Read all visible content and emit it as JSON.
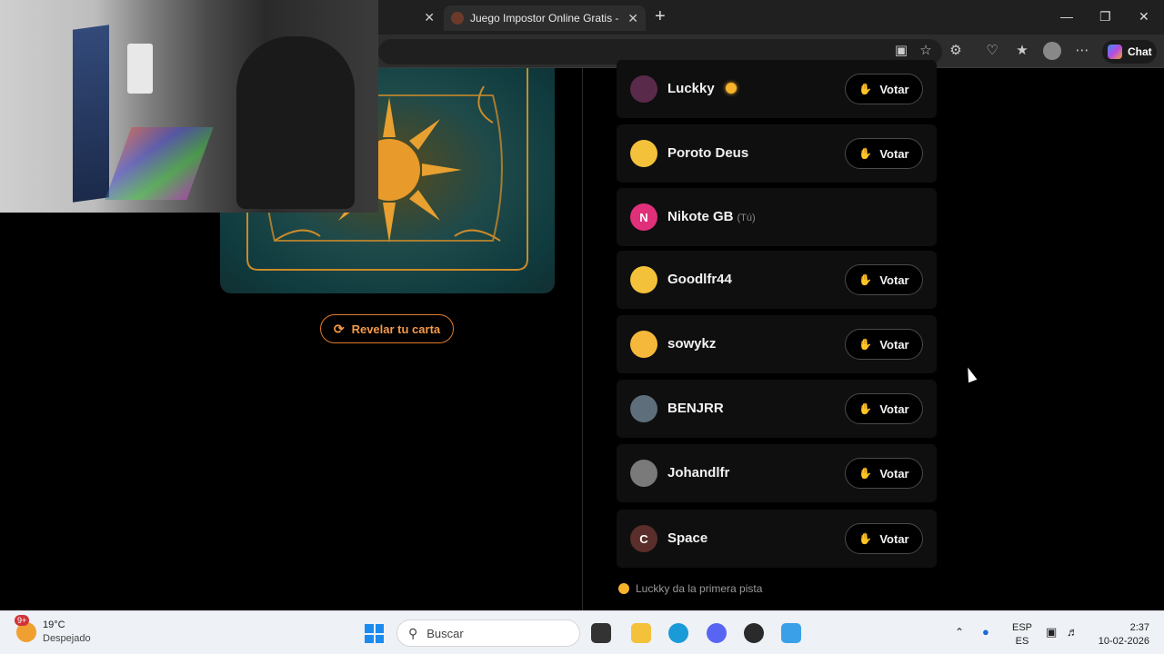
{
  "browser": {
    "prev_tab_close": "✕",
    "active_tab_title": "Juego Impostor Online Gratis - Juego",
    "active_tab_close": "✕",
    "new_tab": "+",
    "chat_label": "Chat"
  },
  "game": {
    "reveal_label": "Revelar tu carta",
    "vote_label": "Votar",
    "you_tag": "(Tú)",
    "players": [
      {
        "name": "Luckky",
        "avatar_text": "",
        "avatar_color": "#5a2a4a",
        "clue_badge": true,
        "can_vote": true
      },
      {
        "name": "Poroto Deus",
        "avatar_text": "",
        "avatar_color": "#f3c13a",
        "clue_badge": false,
        "can_vote": true
      },
      {
        "name": "Nikote GB",
        "avatar_text": "N",
        "avatar_color": "#e0307a",
        "clue_badge": false,
        "can_vote": false,
        "is_you": true
      },
      {
        "name": "Goodlfr44",
        "avatar_text": "",
        "avatar_color": "#f3c13a",
        "clue_badge": false,
        "can_vote": true
      },
      {
        "name": "sowykz",
        "avatar_text": "",
        "avatar_color": "#f5b83a",
        "clue_badge": false,
        "can_vote": true
      },
      {
        "name": "BENJRR",
        "avatar_text": "",
        "avatar_color": "#5e6e7a",
        "clue_badge": false,
        "can_vote": true
      },
      {
        "name": "Johandlfr",
        "avatar_text": "",
        "avatar_color": "#7a7a7a",
        "clue_badge": false,
        "can_vote": true
      },
      {
        "name": "Space",
        "avatar_text": "C",
        "avatar_color": "#5a2e2a",
        "clue_badge": false,
        "can_vote": true
      }
    ],
    "hint_text": "Luckky da la primera pista"
  },
  "taskbar": {
    "weather_badge": "9+",
    "temperature": "19°C",
    "weather_desc": "Despejado",
    "search_placeholder": "Buscar",
    "lang_top": "ESP",
    "lang_bottom": "ES",
    "time": "2:37",
    "date": "10-02-2026"
  }
}
